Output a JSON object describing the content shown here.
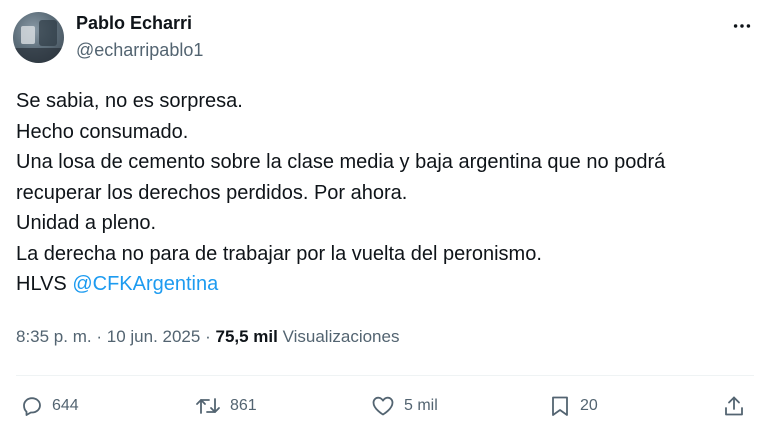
{
  "author": {
    "display_name": "Pablo Echarri",
    "handle": "@echarripablo1"
  },
  "tweet": {
    "lines": [
      "Se sabia, no es sorpresa.",
      "Hecho consumado.",
      "Una losa de cemento sobre la clase media y baja argentina que no podrá",
      "recuperar los derechos perdidos. Por ahora.",
      "Unidad a pleno.",
      "La derecha no para de trabajar por la vuelta del peronismo."
    ],
    "last_line_prefix": "HLVS",
    "mention": "@CFKArgentina"
  },
  "meta": {
    "time": "8:35 p. m.",
    "separator": "·",
    "date": "10 jun. 2025",
    "views_count": "75,5 mil",
    "views_label": "Visualizaciones"
  },
  "actions": {
    "replies": "644",
    "reposts": "861",
    "likes": "5 mil",
    "bookmarks": "20"
  },
  "icons": {
    "more": "more-horizontal-icon",
    "reply": "reply-icon",
    "repost": "repost-icon",
    "like": "heart-icon",
    "bookmark": "bookmark-icon",
    "share": "share-icon"
  },
  "colors": {
    "text": "#0f1419",
    "secondary": "#536471",
    "link": "#1d9bf0",
    "divider": "#eff3f4"
  }
}
